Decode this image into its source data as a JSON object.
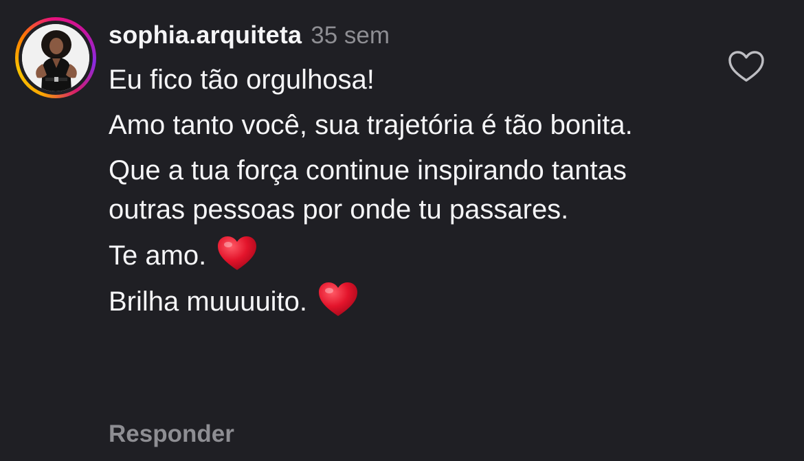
{
  "comment": {
    "username": "sophia.arquiteta",
    "timestamp": "35 sem",
    "paragraphs": [
      {
        "text": "Eu fico tão orgulhosa!"
      },
      {
        "text": "Amo tanto você, sua trajetória é tão bonita."
      },
      {
        "text": "Que a tua força continue inspirando tantas outras pessoas por onde tu passares."
      },
      {
        "text": "Te amo.",
        "emoji": "heart-emoji"
      },
      {
        "text": "Brilha muuuuito.",
        "emoji": "heart-emoji"
      }
    ],
    "reply_label": "Responder"
  },
  "icons": {
    "like": "heart-outline-icon",
    "emoji": "red-heart-emoji"
  },
  "colors": {
    "background": "#1f1f24",
    "text": "#f5f5f7",
    "muted": "#8e8e93",
    "heart_emoji": "#e0142a"
  }
}
